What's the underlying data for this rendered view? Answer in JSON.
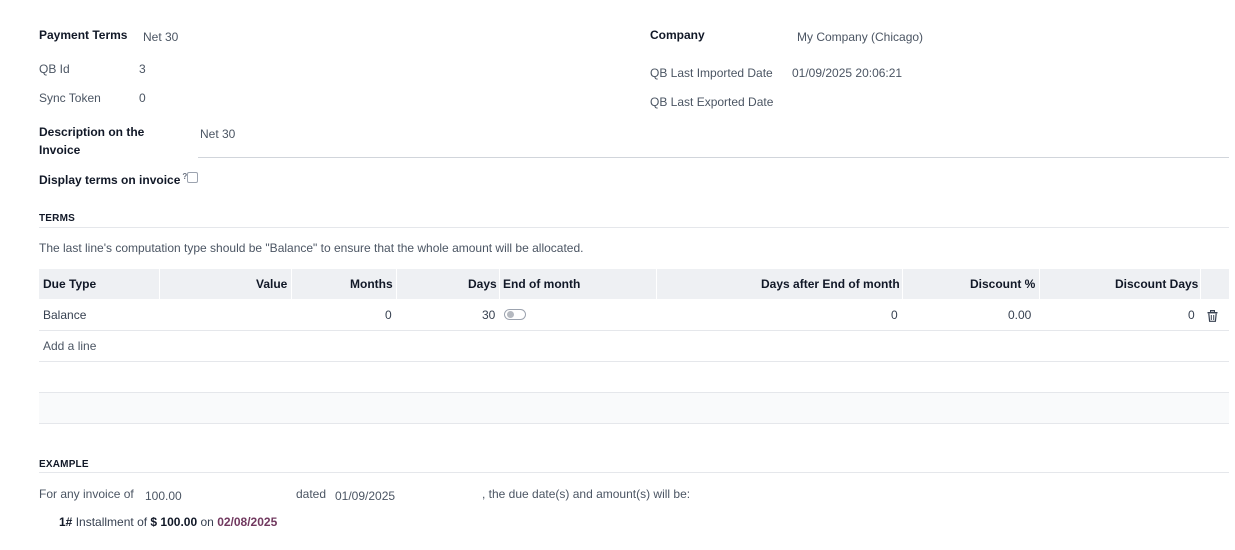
{
  "header": {
    "payment_terms_label": "Payment Terms",
    "payment_terms_value": "Net 30",
    "qb_id_label": "QB Id",
    "qb_id_value": "3",
    "sync_token_label": "Sync Token",
    "sync_token_value": "0",
    "company_label": "Company",
    "company_value": "My Company (Chicago)",
    "qb_last_imported_label": "QB Last Imported Date",
    "qb_last_imported_value": "01/09/2025 20:06:21",
    "qb_last_exported_label": "QB Last Exported Date",
    "description_label_line1": "Description on the",
    "description_label_line2": "Invoice",
    "description_value": "Net 30",
    "display_terms_label": "Display terms on invoice",
    "display_terms_help": "?",
    "display_terms_checked": false
  },
  "terms": {
    "section_title": "TERMS",
    "note": "The last line's computation type should be \"Balance\" to ensure that the whole amount will be allocated.",
    "columns": [
      "Due Type",
      "Value",
      "Months",
      "Days",
      "End of month",
      "Days after End of month",
      "Discount %",
      "Discount Days"
    ],
    "rows": [
      {
        "due_type": "Balance",
        "value": "",
        "months": "0",
        "days": "30",
        "end_of_month": false,
        "days_after_eom": "0",
        "discount_pct": "0.00",
        "discount_days": "0"
      }
    ],
    "add_line": "Add a line"
  },
  "example": {
    "section_title": "EXAMPLE",
    "for_any_invoice_label": "For any invoice of",
    "amount": "100.00",
    "dated_label": "dated",
    "date": "01/09/2025",
    "suffix": ", the due date(s) and amount(s) will be:",
    "installment_number": "1#",
    "installment_text": "Installment of",
    "installment_amount": "$ 100.00",
    "installment_on": "on",
    "installment_date": "02/08/2025"
  },
  "icons": {
    "delete_row": "trash-icon"
  }
}
